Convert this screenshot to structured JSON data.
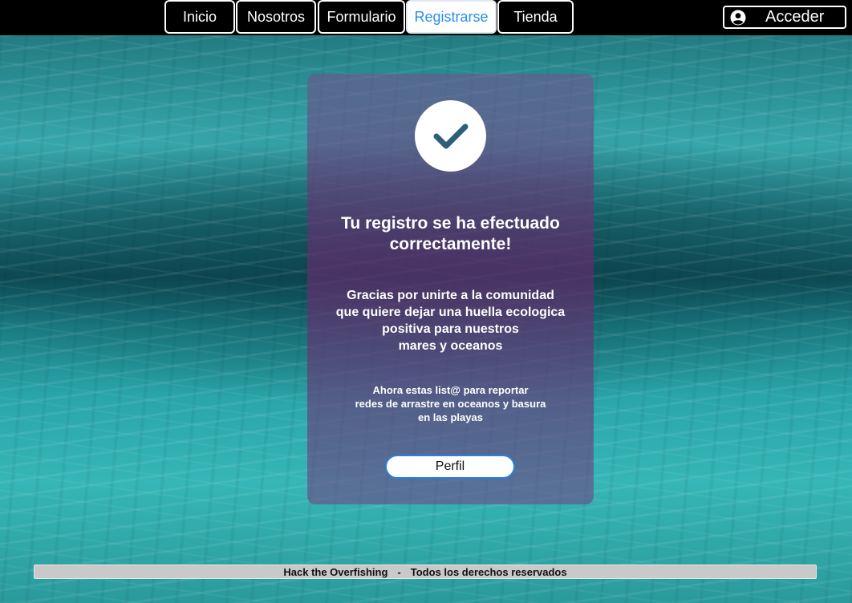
{
  "nav": {
    "items": [
      {
        "label": "Inicio"
      },
      {
        "label": "Nosotros"
      },
      {
        "label": "Formulario"
      },
      {
        "label": "Registrarse"
      },
      {
        "label": "Tienda"
      }
    ],
    "active": "Registrarse",
    "login": {
      "label": "Acceder",
      "icon": "user-circle-icon"
    }
  },
  "card": {
    "icon": "checkmark-icon",
    "title_line1": "Tu registro se ha efectuado",
    "title_line2": "correctamente!",
    "message_lines": [
      "Gracias por unirte a la comunidad",
      "que quiere dejar una huella ecologica",
      "positiva para nuestros",
      "mares y oceanos"
    ],
    "note_lines": [
      "Ahora estas list@ para reportar",
      "redes de arrastre en oceanos y basura",
      "en las playas"
    ],
    "profile_button": "Perfil"
  },
  "footer": {
    "left": "Hack the Overfishing",
    "separator": "-",
    "right": "Todos los derechos reservados"
  },
  "colors": {
    "topbar": "#000000",
    "active_nav_text": "#2b8fe6",
    "card_overlay": "#602c6c",
    "check_color": "#2c5f7a",
    "profile_border": "#2b7fe0",
    "footer_bg": "#c9c9c9"
  }
}
